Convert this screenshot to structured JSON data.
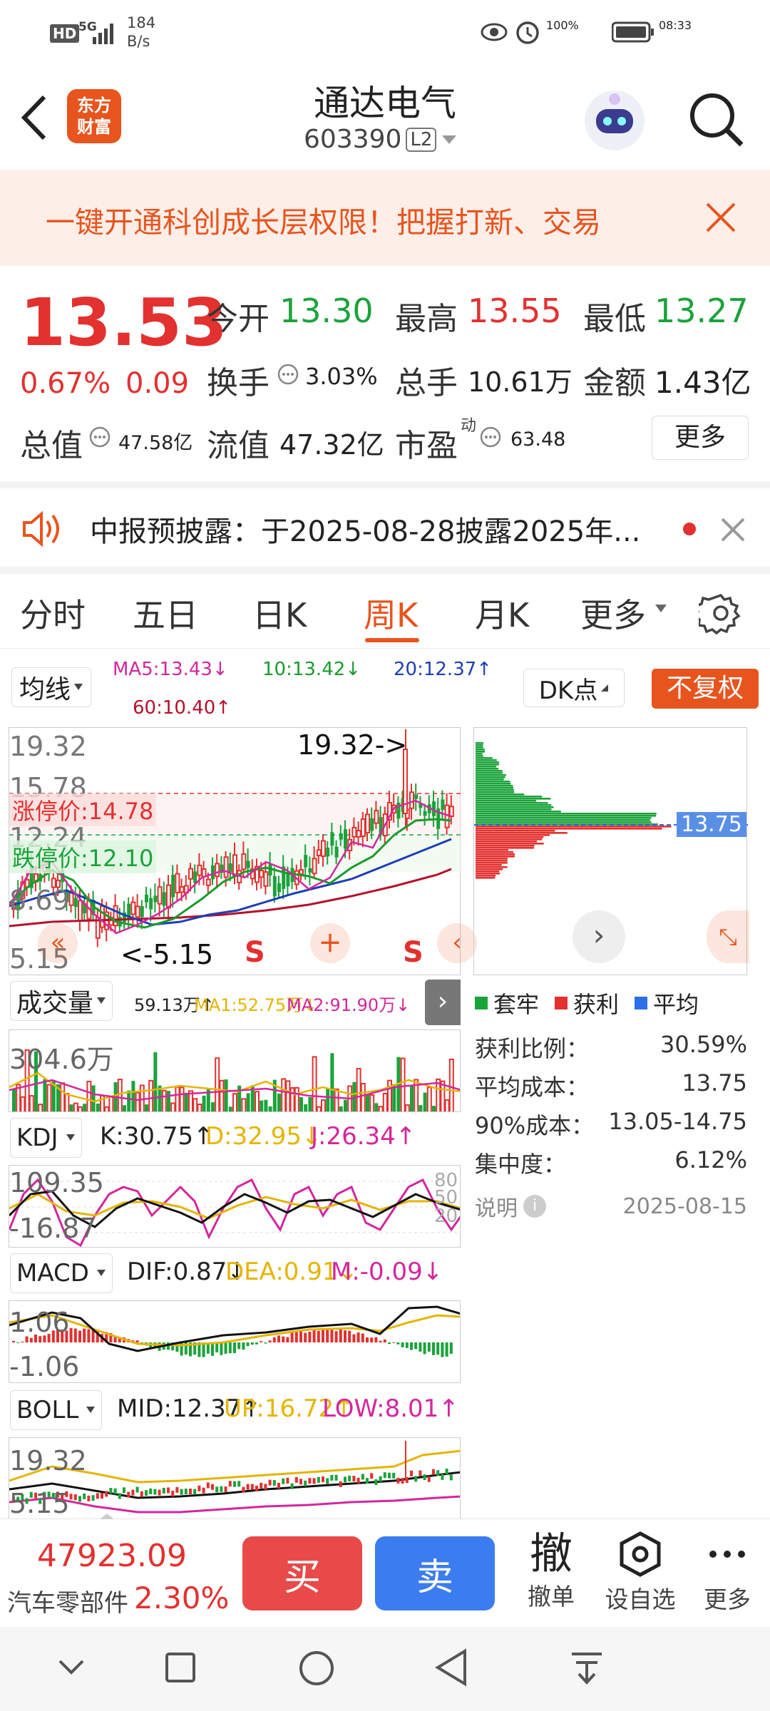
{
  "status_bar": {
    "net1": "HD",
    "net2": "5G",
    "speed": "184",
    "speed_unit": "B/s",
    "battery": "100%",
    "time": "08:33"
  },
  "header": {
    "stock_name": "通达电气",
    "stock_code": "603390",
    "level": "L2",
    "logo_line1": "东方",
    "logo_line2": "财富"
  },
  "banner": {
    "text": "一键开通科创成长层权限！把握打新、交易"
  },
  "quote": {
    "price": "13.53",
    "change_pct": "0.67%",
    "change": "0.09",
    "open_label": "今开",
    "open": "13.30",
    "high_label": "最高",
    "high": "13.55",
    "low_label": "最低",
    "low": "13.27",
    "turnover_label": "换手",
    "turnover": "3.03%",
    "volume_label": "总手",
    "volume": "10.61万",
    "amount_label": "金额",
    "amount": "1.43亿",
    "mktcap_label": "总值",
    "mktcap": "47.58亿",
    "float_label": "流值",
    "float": "47.32亿",
    "pe_label": "市盈",
    "pe_sup": "动",
    "pe": "63.48",
    "more": "更多"
  },
  "notice": {
    "text": "中报预披露：于2025-08-28披露2025年..."
  },
  "tabs": [
    "分时",
    "五日",
    "日K",
    "周K",
    "月K",
    "更多"
  ],
  "chart": {
    "ma_selector": "均线",
    "ma5": "MA5:13.43↓",
    "ma10": "10:13.42↓",
    "ma20": "20:12.37↑",
    "ma60": "60:10.40↑",
    "dk": "DK点",
    "fq": "不复权",
    "y_labels": [
      "19.32",
      "15.78",
      "12.24",
      "8.69",
      "5.15"
    ],
    "limit_up": "涨停价:14.78",
    "limit_down": "跌停价:12.10",
    "max_marker": "19.32->",
    "min_marker": "<-5.15",
    "s1": "S",
    "s2": "S",
    "vol_selector": "成交量",
    "vol_legend": "59.13万↑",
    "vol_ma1": "MA1:52.75万↓",
    "vol_ma2": "MA2:91.90万↓",
    "vol_top": "304.6万",
    "kdj_selector": "KDJ",
    "kdj_k": "K:30.75↑",
    "kdj_d": "D:32.95↓",
    "kdj_j": "J:26.34↑",
    "kdj_top": "109.35",
    "kdj_bottom": "-16.87",
    "kdj_80": "80",
    "kdj_50": "50",
    "kdj_20": "20",
    "macd_selector": "MACD",
    "macd_dif": "DIF:0.87↓",
    "macd_dea": "DEA:0.91↓",
    "macd_m": "M:-0.09↓",
    "macd_top": "1.06",
    "macd_bottom": "-1.06",
    "boll_selector": "BOLL",
    "boll_mid": "MID:12.37↑",
    "boll_up": "UP:16.72↑",
    "boll_low": "LOW:8.01↑",
    "boll_top": "19.32",
    "boll_bottom": "5.15"
  },
  "chip": {
    "price_tag": "13.75",
    "legend_trapped": "套牢",
    "legend_profit": "获利",
    "legend_avg": "平均",
    "rows": [
      {
        "label": "获利比例：",
        "value": "30.59%"
      },
      {
        "label": "平均成本：",
        "value": "13.75"
      },
      {
        "label": "90%成本：",
        "value": "13.05-14.75"
      },
      {
        "label": "集中度：",
        "value": "6.12%"
      }
    ],
    "note_label": "说明",
    "date": "2025-08-15"
  },
  "bottom": {
    "index_value": "47923.09",
    "sector": "汽车零部件",
    "sector_pct": "2.30%",
    "buy": "买",
    "sell": "卖",
    "cancel": "撤单",
    "cancel_icon": "撤",
    "watch": "设自选",
    "more": "更多"
  },
  "colors": {
    "red": "#e2312f",
    "green": "#1aa33a",
    "orange": "#e8541e",
    "blue": "#2b6fe6"
  }
}
